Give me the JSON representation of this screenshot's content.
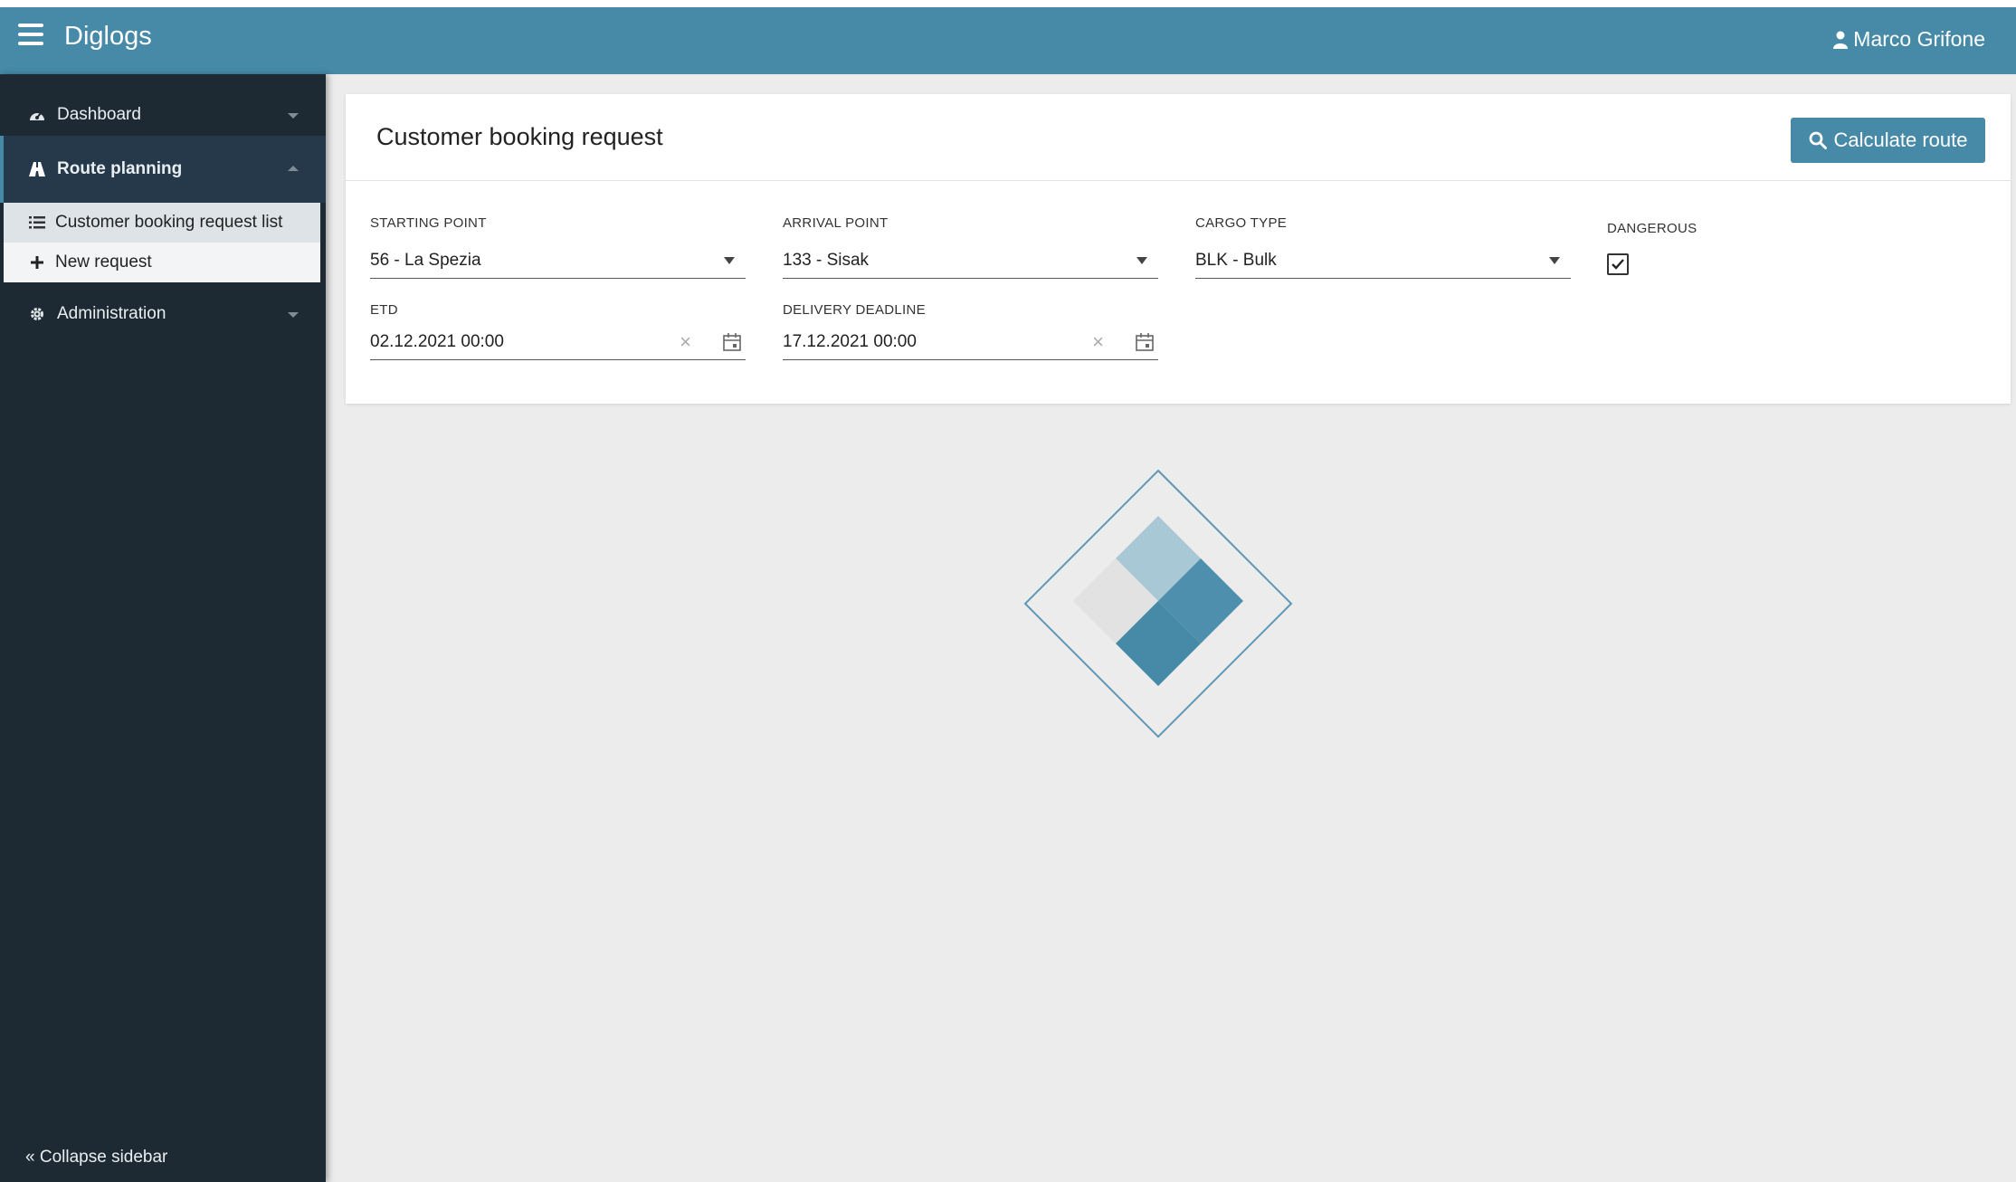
{
  "app": {
    "title": "Diglogs",
    "user": "Marco Grifone"
  },
  "sidebar": {
    "items": [
      {
        "label": "Dashboard",
        "icon": "dashboard-icon"
      },
      {
        "label": "Route planning",
        "icon": "road-icon"
      },
      {
        "label": "Administration",
        "icon": "gear-icon"
      }
    ],
    "subitems": [
      {
        "label": "Customer booking request list",
        "icon": "list-icon"
      },
      {
        "label": "New request",
        "icon": "plus-icon"
      }
    ],
    "collapse_label": "Collapse sidebar"
  },
  "page": {
    "title": "Customer booking request",
    "calculate_button": "Calculate route"
  },
  "form": {
    "starting_point": {
      "label": "STARTING POINT",
      "value": "56 - La Spezia"
    },
    "arrival_point": {
      "label": "ARRIVAL POINT",
      "value": "133 - Sisak"
    },
    "cargo_type": {
      "label": "CARGO TYPE",
      "value": "BLK - Bulk"
    },
    "dangerous": {
      "label": "DANGEROUS",
      "checked": true
    },
    "etd": {
      "label": "ETD",
      "value": "02.12.2021 00:00"
    },
    "delivery_deadline": {
      "label": "DELIVERY DEADLINE",
      "value": "17.12.2021 00:00"
    }
  },
  "colors": {
    "accent": "#468aa8",
    "sidebar_bg": "#1e2a33",
    "content_bg": "#ececec"
  }
}
